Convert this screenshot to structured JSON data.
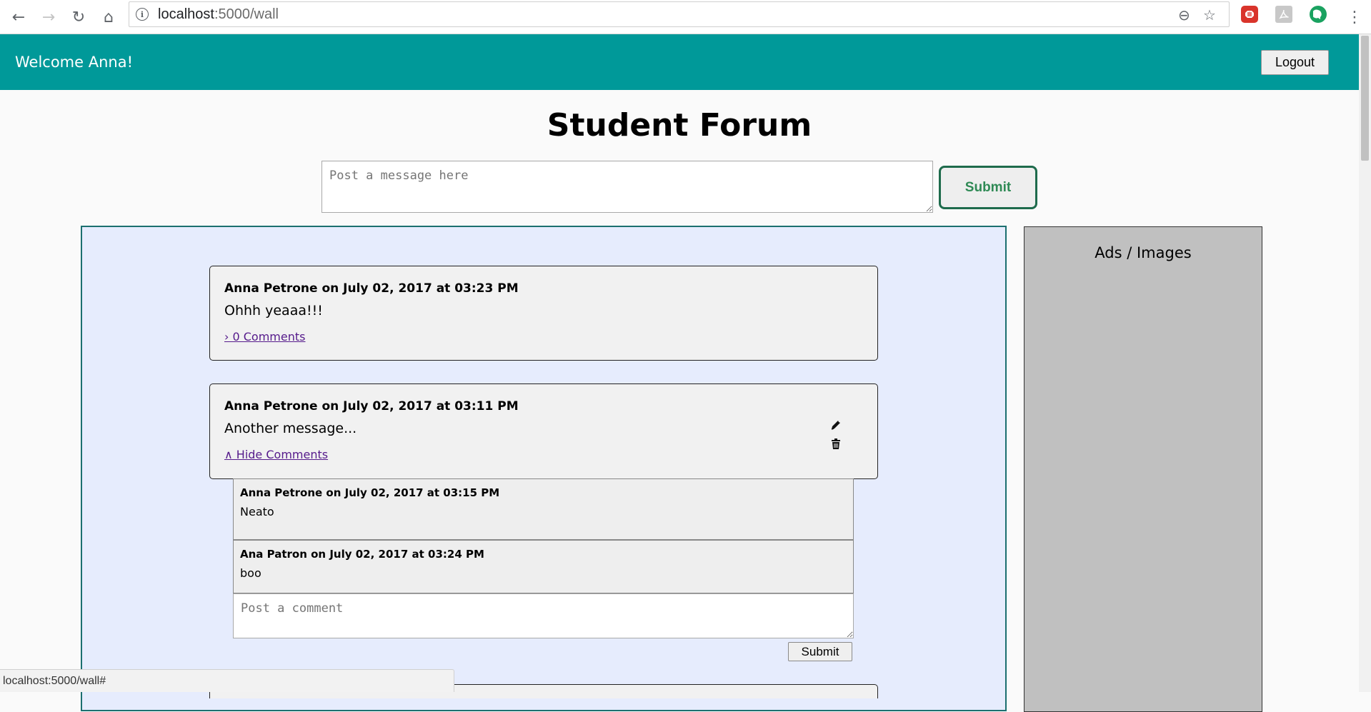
{
  "browser": {
    "url_host": "localhost",
    "url_path": ":5000/wall",
    "back_icon": "←",
    "forward_icon": "→",
    "reload_icon": "↻",
    "home_icon": "⌂",
    "info_icon": "i",
    "zoom_icon": "⊖",
    "star_icon": "☆",
    "menu_icon": "⋮",
    "status_text": "localhost:5000/wall#"
  },
  "header": {
    "welcome": "Welcome Anna!",
    "logout_label": "Logout",
    "color": "#009999"
  },
  "page": {
    "title": "Student Forum",
    "post_placeholder": "Post a message here",
    "submit_label": "Submit"
  },
  "ads": {
    "title": "Ads / Images"
  },
  "posts": [
    {
      "header": "Anna Petrone on July 02, 2017 at 03:23 PM",
      "body": "Ohhh yeaaa!!!",
      "comments_link": "› 0 Comments"
    },
    {
      "header": "Anna Petrone on July 02, 2017 at 03:11 PM",
      "body": "Another message...",
      "comments_link": "∧ Hide Comments",
      "comments": [
        {
          "header": "Anna Petrone on July 02, 2017 at 03:15 PM",
          "body": "Neato"
        },
        {
          "header": "Ana Patron on July 02, 2017 at 03:24 PM",
          "body": "boo"
        }
      ],
      "comment_placeholder": "Post a comment",
      "comment_submit_label": "Submit"
    }
  ]
}
